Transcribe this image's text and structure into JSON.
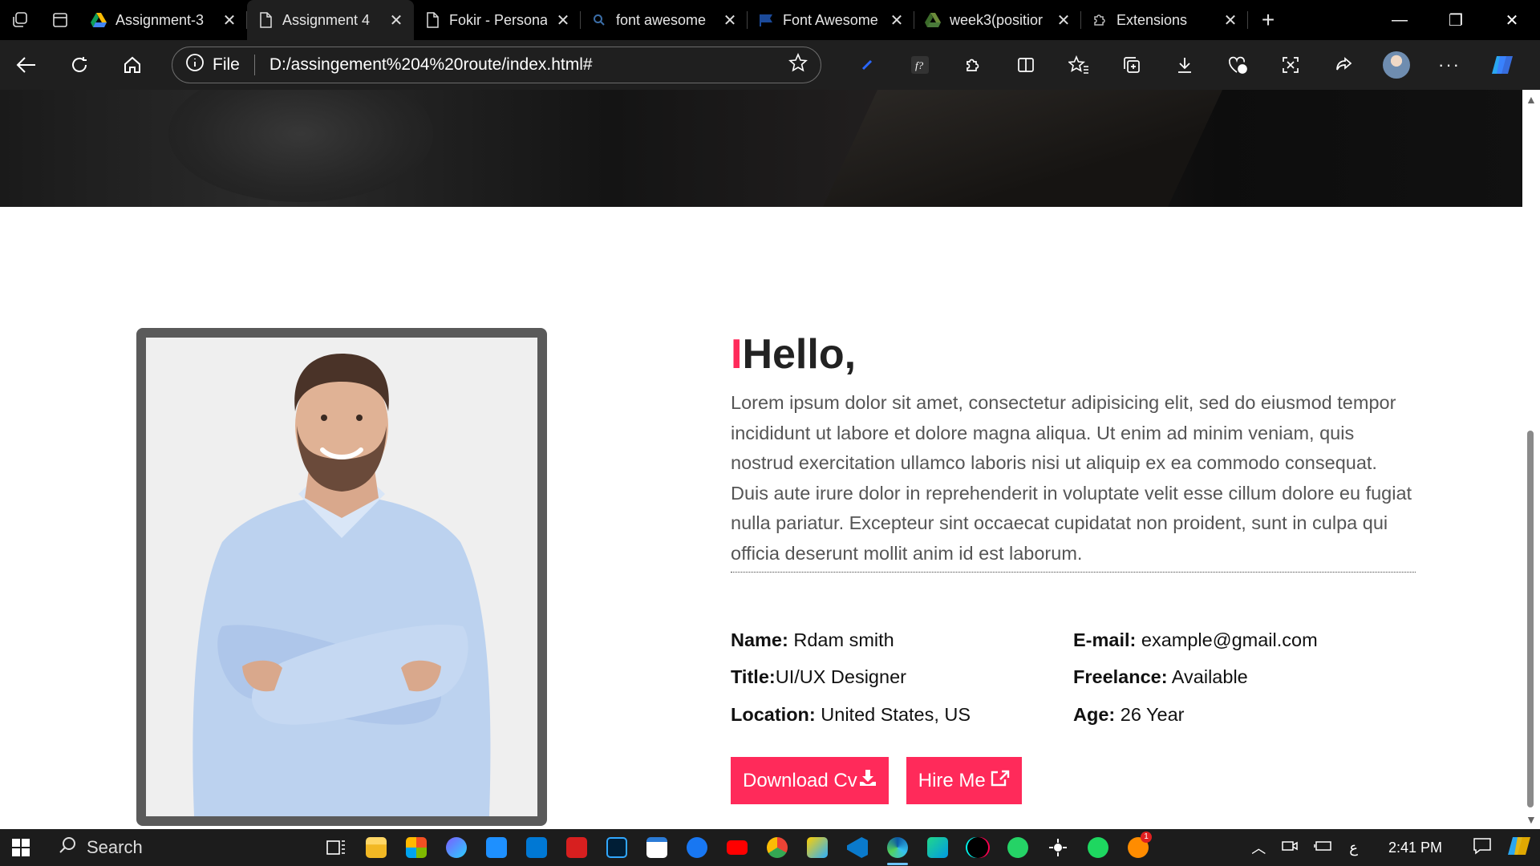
{
  "browser": {
    "tabs": [
      {
        "label": "Assignment-3",
        "icon": "google-drive-icon",
        "active": false
      },
      {
        "label": "Assignment 4",
        "icon": "page-icon",
        "active": true
      },
      {
        "label": "Fokir - Persona",
        "icon": "page-icon",
        "active": false
      },
      {
        "label": "font awesome",
        "icon": "search-icon",
        "active": false
      },
      {
        "label": "Font Awesome",
        "icon": "flag-icon",
        "active": false
      },
      {
        "label": "week3(positior",
        "icon": "google-drive-icon",
        "active": false
      },
      {
        "label": "Extensions",
        "icon": "extensions-icon",
        "active": false
      }
    ],
    "address": {
      "scheme_label": "File",
      "url": "D:/assingement%204%20route/index.html#"
    }
  },
  "about": {
    "greeting": "Hello,",
    "greeting_bar": "I",
    "paragraph": "Lorem ipsum dolor sit amet, consectetur adipisicing elit, sed do eiusmod tempor incididunt ut labore et dolore magna aliqua. Ut enim ad minim veniam, quis nostrud exercitation ullamco laboris nisi ut aliquip ex ea commodo consequat. Duis aute irure dolor in reprehenderit in voluptate velit esse cillum dolore eu fugiat nulla pariatur. Excepteur sint occaecat cupidatat non proident, sunt in culpa qui officia deserunt mollit anim id est laborum.",
    "info": [
      {
        "label": "Name:",
        "value": " Rdam smith"
      },
      {
        "label": "E-mail:",
        "value": " example@gmail.com"
      },
      {
        "label": "Title:",
        "value": "UI/UX Designer"
      },
      {
        "label": "Freelance:",
        "value": " Available"
      },
      {
        "label": "Location:",
        "value": " United States, US"
      },
      {
        "label": "Age:",
        "value": " 26 Year"
      }
    ],
    "buttons": {
      "download": "Download Cv",
      "hire": "Hire Me"
    },
    "accent_color": "#ff2a5a"
  },
  "taskbar": {
    "search_label": "Search",
    "time": "2:41 PM",
    "language": "ع",
    "notification_count": "1"
  }
}
